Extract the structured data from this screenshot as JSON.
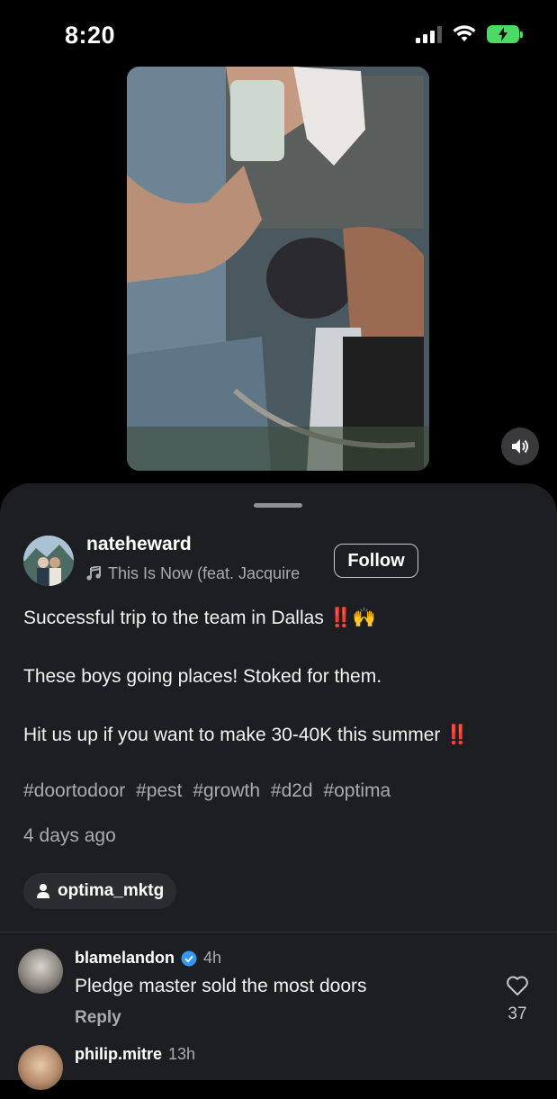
{
  "status": {
    "time": "8:20"
  },
  "post": {
    "author": "nateheward",
    "music": "This Is Now (feat. Jacquire",
    "follow_label": "Follow",
    "caption_line1": "Successful trip to the team in Dallas ‼️🙌",
    "caption_line2": "These boys going places! Stoked for them.",
    "caption_line3": "Hit us up if you want to make 30-40K this summer ‼️",
    "hashtags": [
      "#doortodoor",
      "#pest",
      "#growth",
      "#d2d",
      "#optima"
    ],
    "timestamp": "4 days ago",
    "tagged_user": "optima_mktg"
  },
  "comments": [
    {
      "username": "blamelandon",
      "verified": true,
      "time": "4h",
      "text": "Pledge master sold the most doors",
      "reply_label": "Reply",
      "likes": "37"
    },
    {
      "username": "philip.mitre",
      "time": "13h"
    }
  ],
  "colors": {
    "sheet_bg": "#1c1e21",
    "verified": "#3897f0",
    "battery": "#4cd964",
    "emoji_red": "#e0245e"
  }
}
